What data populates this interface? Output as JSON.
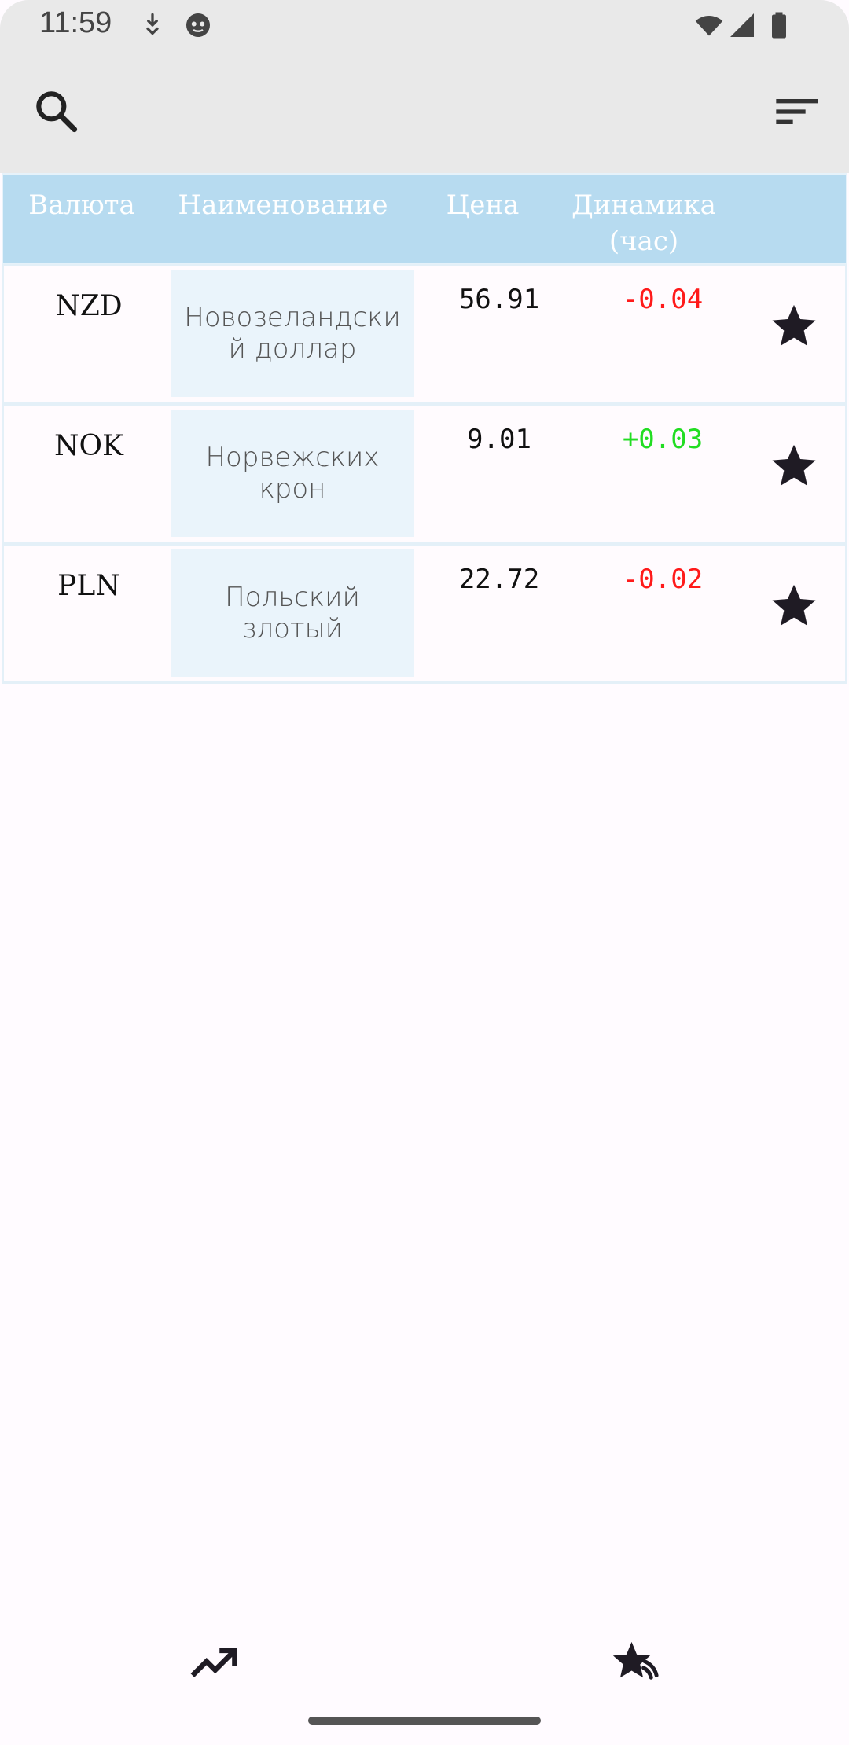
{
  "status_bar": {
    "time": "11:59"
  },
  "table": {
    "headers": [
      "Валюта",
      "Наименование",
      "Цена",
      "Динамика\n(час)"
    ],
    "rows": [
      {
        "code": "NZD",
        "name": "Новозеландский доллар",
        "price": "56.91",
        "change": "-0.04",
        "change_color": "#ff1a1a"
      },
      {
        "code": "NOK",
        "name": "Норвежских крон",
        "price": "9.01",
        "change": "+0.03",
        "change_color": "#22dd22"
      },
      {
        "code": "PLN",
        "name": "Польский злотый",
        "price": "22.72",
        "change": "-0.02",
        "change_color": "#ff1a1a"
      }
    ]
  },
  "icons": {
    "search": "search-icon",
    "sort": "sort-icon",
    "favorite": "star-icon",
    "nav_trends": "trending-up-icon",
    "nav_favorites": "favorites-icon"
  },
  "colors": {
    "header_bg": "#b7dbf0",
    "name_bg": "#eaf4fb",
    "appbar_bg": "#e9e9e9"
  }
}
